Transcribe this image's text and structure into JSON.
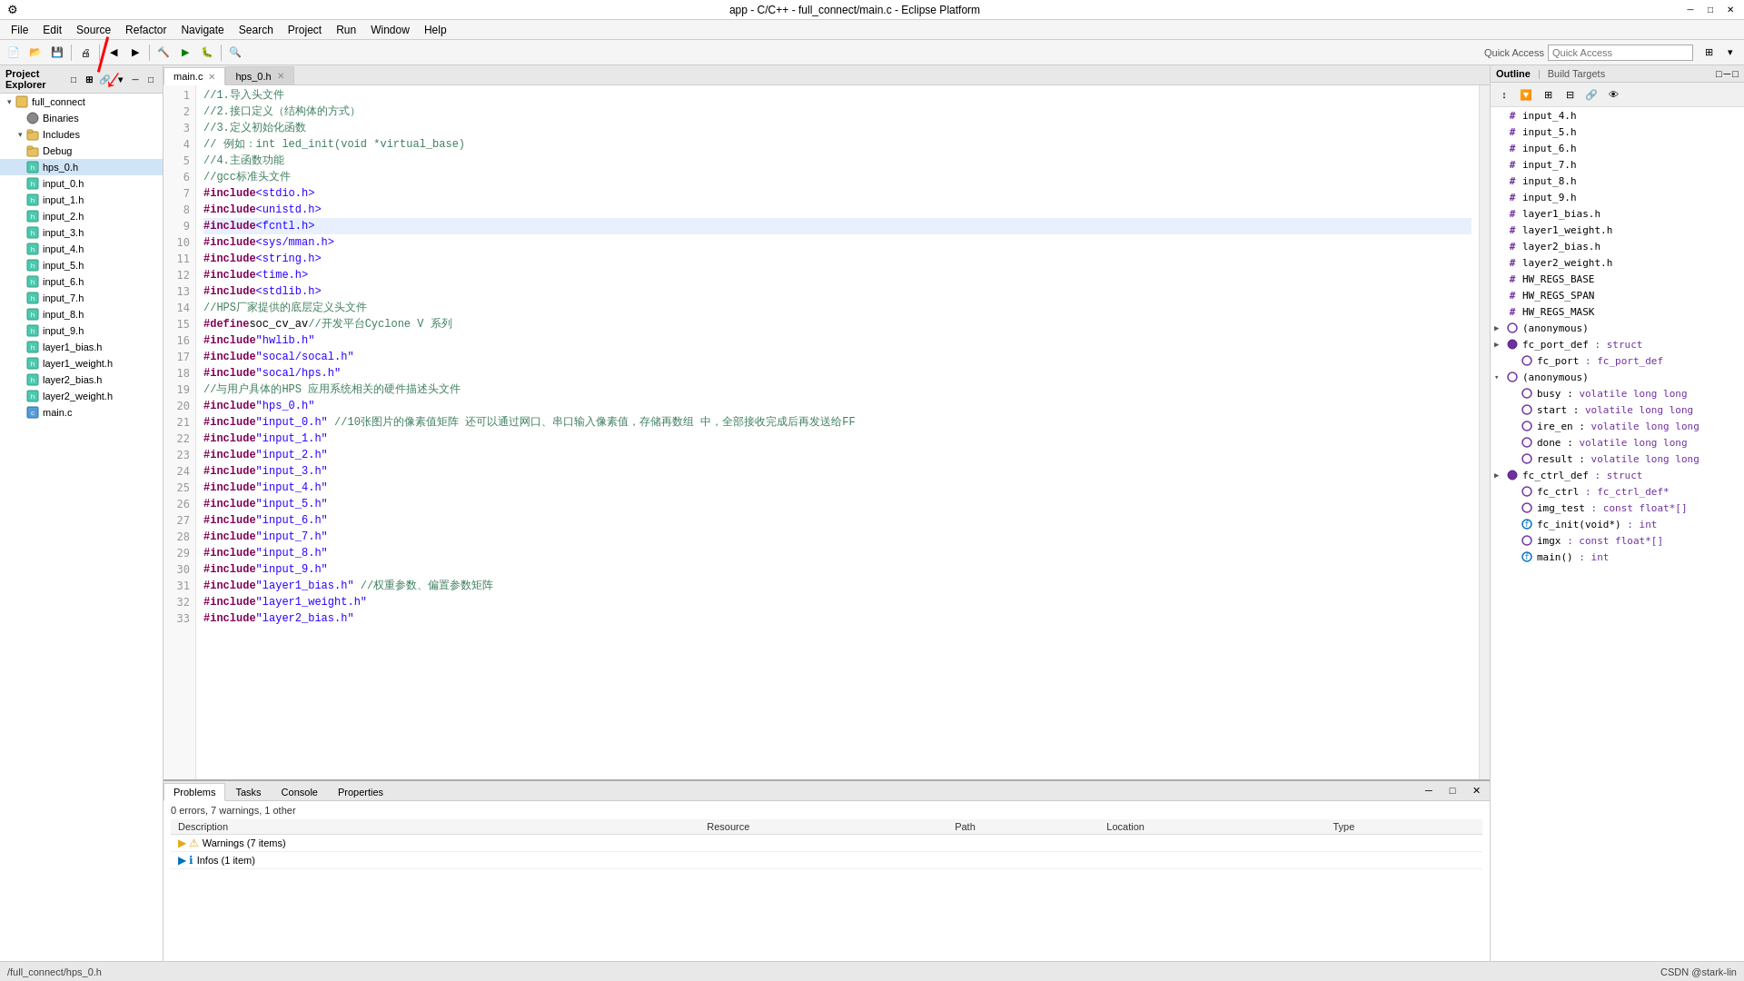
{
  "titleBar": {
    "title": "app - C/C++ - full_connect/main.c - Eclipse Platform",
    "minimizeBtn": "─",
    "maximizeBtn": "□",
    "closeBtn": "✕"
  },
  "menuBar": {
    "items": [
      "File",
      "Edit",
      "Source",
      "Refactor",
      "Navigate",
      "Search",
      "Project",
      "Run",
      "Window",
      "Help"
    ]
  },
  "quickAccess": {
    "label": "Quick Access",
    "placeholder": ""
  },
  "projectExplorer": {
    "title": "Project Explorer",
    "tree": [
      {
        "level": 0,
        "arrow": "▾",
        "icon": "📁",
        "label": "full_connect",
        "type": "project"
      },
      {
        "level": 1,
        "arrow": "",
        "icon": "🔧",
        "label": "Binaries",
        "type": "binaries"
      },
      {
        "level": 1,
        "arrow": "▾",
        "icon": "📂",
        "label": "Includes",
        "type": "includes",
        "selected": false
      },
      {
        "level": 1,
        "arrow": "",
        "icon": "📂",
        "label": "Debug",
        "type": "folder"
      },
      {
        "level": 1,
        "arrow": "",
        "icon": "📄",
        "label": "hps_0.h",
        "type": "header",
        "selected": false
      },
      {
        "level": 1,
        "arrow": "",
        "icon": "📄",
        "label": "input_0.h",
        "type": "header"
      },
      {
        "level": 1,
        "arrow": "",
        "icon": "📄",
        "label": "input_1.h",
        "type": "header"
      },
      {
        "level": 1,
        "arrow": "",
        "icon": "📄",
        "label": "input_2.h",
        "type": "header"
      },
      {
        "level": 1,
        "arrow": "",
        "icon": "📄",
        "label": "input_3.h",
        "type": "header"
      },
      {
        "level": 1,
        "arrow": "",
        "icon": "📄",
        "label": "input_4.h",
        "type": "header"
      },
      {
        "level": 1,
        "arrow": "",
        "icon": "📄",
        "label": "input_5.h",
        "type": "header"
      },
      {
        "level": 1,
        "arrow": "",
        "icon": "📄",
        "label": "input_6.h",
        "type": "header"
      },
      {
        "level": 1,
        "arrow": "",
        "icon": "📄",
        "label": "input_7.h",
        "type": "header"
      },
      {
        "level": 1,
        "arrow": "",
        "icon": "📄",
        "label": "input_8.h",
        "type": "header"
      },
      {
        "level": 1,
        "arrow": "",
        "icon": "📄",
        "label": "input_9.h",
        "type": "header"
      },
      {
        "level": 1,
        "arrow": "",
        "icon": "📄",
        "label": "layer1_bias.h",
        "type": "header"
      },
      {
        "level": 1,
        "arrow": "",
        "icon": "📄",
        "label": "layer1_weight.h",
        "type": "header"
      },
      {
        "level": 1,
        "arrow": "",
        "icon": "📄",
        "label": "layer2_bias.h",
        "type": "header"
      },
      {
        "level": 1,
        "arrow": "",
        "icon": "📄",
        "label": "layer2_weight.h",
        "type": "header"
      },
      {
        "level": 1,
        "arrow": "",
        "icon": "📄",
        "label": "main.c",
        "type": "source"
      }
    ]
  },
  "editor": {
    "tabs": [
      {
        "label": "main.c",
        "active": true,
        "closeable": true
      },
      {
        "label": "hps_0.h",
        "active": false,
        "closeable": true
      }
    ],
    "lines": [
      {
        "num": 1,
        "content": "//1.导入头文件",
        "type": "comment"
      },
      {
        "num": 2,
        "content": "//2.接口定义（结构体的方式）",
        "type": "comment"
      },
      {
        "num": 3,
        "content": "//3.定义初始化函数",
        "type": "comment"
      },
      {
        "num": 4,
        "content": "// 例如：int led_init(void *virtual_base)",
        "type": "comment"
      },
      {
        "num": 5,
        "content": "//4.主函数功能",
        "type": "comment"
      },
      {
        "num": 6,
        "content": "//gcc标准头文件",
        "type": "comment"
      },
      {
        "num": 7,
        "content": "#include <stdio.h>",
        "type": "include-sys"
      },
      {
        "num": 8,
        "content": "#include <unistd.h>",
        "type": "include-sys"
      },
      {
        "num": 9,
        "content": "#include <fcntl.h>",
        "type": "include-sys",
        "highlighted": true
      },
      {
        "num": 10,
        "content": "#include <sys/mman.h>",
        "type": "include-sys"
      },
      {
        "num": 11,
        "content": "#include <string.h>",
        "type": "include-sys"
      },
      {
        "num": 12,
        "content": "#include <time.h>",
        "type": "include-sys"
      },
      {
        "num": 13,
        "content": "#include <stdlib.h>",
        "type": "include-sys"
      },
      {
        "num": 14,
        "content": "//HPS厂家提供的底层定义头文件",
        "type": "comment"
      },
      {
        "num": 15,
        "content": "#define soc_cv_av //开发平台Cyclone V 系列",
        "type": "define"
      },
      {
        "num": 16,
        "content": "#include \"hwlib.h\"",
        "type": "include-user"
      },
      {
        "num": 17,
        "content": "#include \"socal/socal.h\"",
        "type": "include-user"
      },
      {
        "num": 18,
        "content": "#include \"socal/hps.h\"",
        "type": "include-user"
      },
      {
        "num": 19,
        "content": "//与用户具体的HPS 应用系统相关的硬件描述头文件",
        "type": "comment"
      },
      {
        "num": 20,
        "content": "#include \"hps_0.h\"",
        "type": "include-user"
      },
      {
        "num": 21,
        "content": "#include \"input_0.h\" //10张图片的像素值矩阵 还可以通过网口、串口输入像素值，存储再数组 中，全部接收完成后再发送给FF",
        "type": "include-user-long"
      },
      {
        "num": 22,
        "content": "#include \"input_1.h\"",
        "type": "include-user"
      },
      {
        "num": 23,
        "content": "#include \"input_2.h\"",
        "type": "include-user"
      },
      {
        "num": 24,
        "content": "#include \"input_3.h\"",
        "type": "include-user"
      },
      {
        "num": 25,
        "content": "#include \"input_4.h\"",
        "type": "include-user"
      },
      {
        "num": 26,
        "content": "#include \"input_5.h\"",
        "type": "include-user"
      },
      {
        "num": 27,
        "content": "#include \"input_6.h\"",
        "type": "include-user"
      },
      {
        "num": 28,
        "content": "#include \"input_7.h\"",
        "type": "include-user"
      },
      {
        "num": 29,
        "content": "#include \"input_8.h\"",
        "type": "include-user"
      },
      {
        "num": 30,
        "content": "#include \"input_9.h\"",
        "type": "include-user"
      },
      {
        "num": 31,
        "content": "#include \"layer1_bias.h\" //权重参数、偏置参数矩阵",
        "type": "include-user"
      },
      {
        "num": 32,
        "content": "#include \"layer1_weight.h\"",
        "type": "include-user"
      },
      {
        "num": 33,
        "content": "#include \"layer2_bias.h\"",
        "type": "include-user"
      }
    ]
  },
  "outline": {
    "title": "Outline",
    "buildTargetsTitle": "Build Targets",
    "items": [
      {
        "level": 0,
        "arrow": "",
        "icon": "#",
        "label": "input_4.h",
        "type": "hash"
      },
      {
        "level": 0,
        "arrow": "",
        "icon": "#",
        "label": "input_5.h",
        "type": "hash"
      },
      {
        "level": 0,
        "arrow": "",
        "icon": "#",
        "label": "input_6.h",
        "type": "hash"
      },
      {
        "level": 0,
        "arrow": "",
        "icon": "#",
        "label": "input_7.h",
        "type": "hash"
      },
      {
        "level": 0,
        "arrow": "",
        "icon": "#",
        "label": "input_8.h",
        "type": "hash"
      },
      {
        "level": 0,
        "arrow": "",
        "icon": "#",
        "label": "input_9.h",
        "type": "hash"
      },
      {
        "level": 0,
        "arrow": "",
        "icon": "#",
        "label": "layer1_bias.h",
        "type": "hash"
      },
      {
        "level": 0,
        "arrow": "",
        "icon": "#",
        "label": "layer1_weight.h",
        "type": "hash"
      },
      {
        "level": 0,
        "arrow": "",
        "icon": "#",
        "label": "layer2_bias.h",
        "type": "hash"
      },
      {
        "level": 0,
        "arrow": "",
        "icon": "#",
        "label": "layer2_weight.h",
        "type": "hash"
      },
      {
        "level": 0,
        "arrow": "",
        "icon": "#",
        "label": "HW_REGS_BASE",
        "type": "hash"
      },
      {
        "level": 0,
        "arrow": "",
        "icon": "#",
        "label": "HW_REGS_SPAN",
        "type": "hash"
      },
      {
        "level": 0,
        "arrow": "",
        "icon": "#",
        "label": "HW_REGS_MASK",
        "type": "hash"
      },
      {
        "level": 0,
        "arrow": "▶",
        "icon": "○",
        "label": "(anonymous)",
        "type": "anon"
      },
      {
        "level": 0,
        "arrow": "▶",
        "icon": "●",
        "label": "fc_port_def : struct",
        "type": "struct"
      },
      {
        "level": 1,
        "arrow": "",
        "icon": "○",
        "label": "fc_port : fc_port_def",
        "type": "field"
      },
      {
        "level": 0,
        "arrow": "▾",
        "icon": "○",
        "label": "(anonymous)",
        "type": "anon"
      },
      {
        "level": 1,
        "arrow": "",
        "icon": "○",
        "label": "busy : volatile long long",
        "type": "field"
      },
      {
        "level": 1,
        "arrow": "",
        "icon": "○",
        "label": "start : volatile long long",
        "type": "field"
      },
      {
        "level": 1,
        "arrow": "",
        "icon": "○",
        "label": "ire_en : volatile long long",
        "type": "field"
      },
      {
        "level": 1,
        "arrow": "",
        "icon": "○",
        "label": "done : volatile long long",
        "type": "field"
      },
      {
        "level": 1,
        "arrow": "",
        "icon": "○",
        "label": "result : volatile long long",
        "type": "field"
      },
      {
        "level": 0,
        "arrow": "▶",
        "icon": "●",
        "label": "fc_ctrl_def : struct",
        "type": "struct"
      },
      {
        "level": 1,
        "arrow": "",
        "icon": "○",
        "label": "fc_ctrl : fc_ctrl_def*",
        "type": "field"
      },
      {
        "level": 1,
        "arrow": "",
        "icon": "○",
        "label": "img_test : const float*[]",
        "type": "field"
      },
      {
        "level": 1,
        "arrow": "",
        "icon": "○",
        "label": "fc_init(void*) : int",
        "type": "func"
      },
      {
        "level": 1,
        "arrow": "",
        "icon": "○",
        "label": "imgx : const float*[]",
        "type": "field"
      },
      {
        "level": 1,
        "arrow": "",
        "icon": "○",
        "label": "main() : int",
        "type": "func"
      }
    ]
  },
  "bottomPanel": {
    "tabs": [
      "Problems",
      "Tasks",
      "Console",
      "Properties"
    ],
    "activeTab": "Problems",
    "summary": "0 errors, 7 warnings, 1 other",
    "columns": [
      "Description",
      "Resource",
      "Path",
      "Location",
      "Type"
    ],
    "rows": [
      {
        "icon": "warn",
        "label": "Warnings (7 items)",
        "hasArrow": true
      },
      {
        "icon": "info",
        "label": "Infos (1 item)",
        "hasArrow": true
      }
    ]
  },
  "statusBar": {
    "left": "/full_connect/hps_0.h",
    "right": "CSDN @stark-lin"
  }
}
